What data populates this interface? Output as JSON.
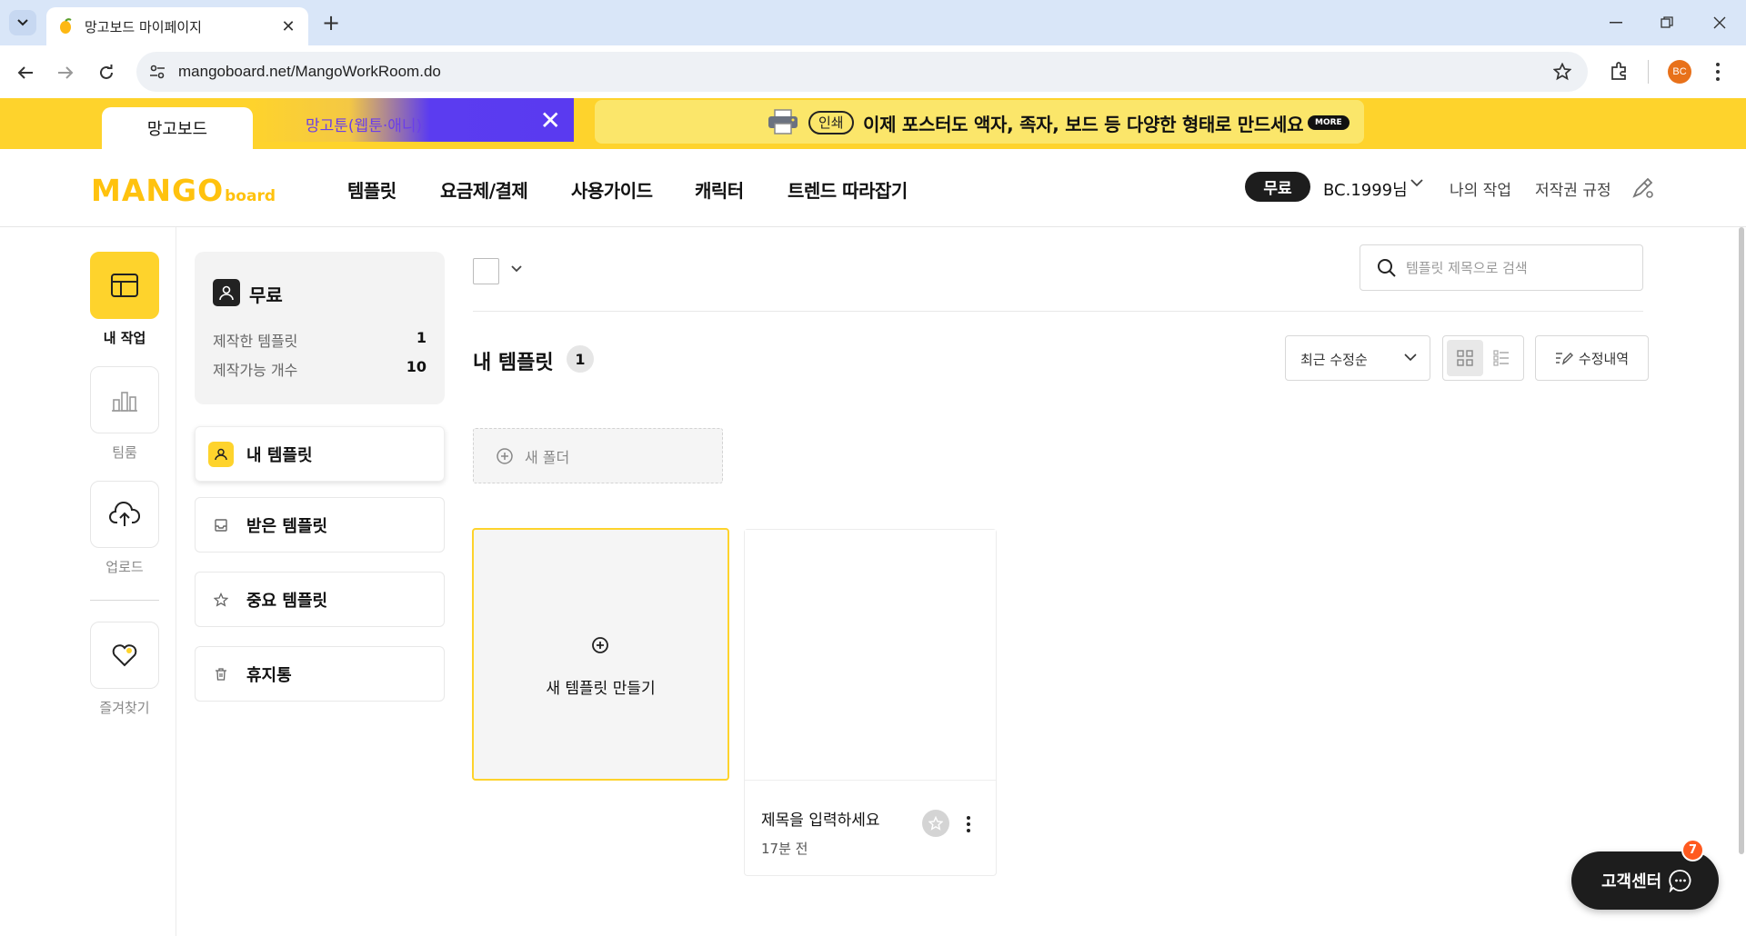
{
  "browser": {
    "tab_title": "망고보드 마이페이지",
    "url": "mangoboard.net/MangoWorkRoom.do",
    "profile_initials": "BC"
  },
  "banner": {
    "tab_mango": "망고보드",
    "tab_toon": "망고툰(웹툰·애니)",
    "print_badge": "인쇄",
    "print_text": "이제 포스터도 액자, 족자, 보드 등 다양한 형태로 만드세요",
    "more_label": "MORE"
  },
  "header": {
    "logo_main": "MANGO",
    "logo_sub": "board",
    "nav": [
      "템플릿",
      "요금제/결제",
      "사용가이드",
      "캐릭터",
      "트렌드 따라잡기"
    ],
    "plan": "무료",
    "user": "BC.1999님",
    "my_work": "나의 작업",
    "copyright": "저작권 규정"
  },
  "rail": {
    "items": [
      {
        "label": "내 작업",
        "icon": "layout-icon"
      },
      {
        "label": "팀룸",
        "icon": "chart-building-icon"
      },
      {
        "label": "업로드",
        "icon": "cloud-upload-icon"
      },
      {
        "label": "즐겨찾기",
        "icon": "heart-icon"
      }
    ]
  },
  "plan_card": {
    "name": "무료",
    "made_label": "제작한 템플릿",
    "made_value": "1",
    "limit_label": "제작가능 개수",
    "limit_value": "10"
  },
  "menu": {
    "items": [
      "내 템플릿",
      "받은 템플릿",
      "중요 템플릿",
      "휴지통"
    ]
  },
  "main": {
    "search_placeholder": "템플릿 제목으로 검색",
    "title": "내 템플릿",
    "count": "1",
    "sort": "최근 수정순",
    "history": "수정내역",
    "new_folder": "새 폴더",
    "new_template": "새 템플릿 만들기"
  },
  "templates": [
    {
      "title": "제목을 입력하세요",
      "time": "17분 전"
    }
  ],
  "support": {
    "label": "고객센터",
    "badge": "7"
  },
  "colors": {
    "accent": "#fed32c",
    "dark": "#1d1d1d",
    "badge": "#ff5a1f"
  }
}
